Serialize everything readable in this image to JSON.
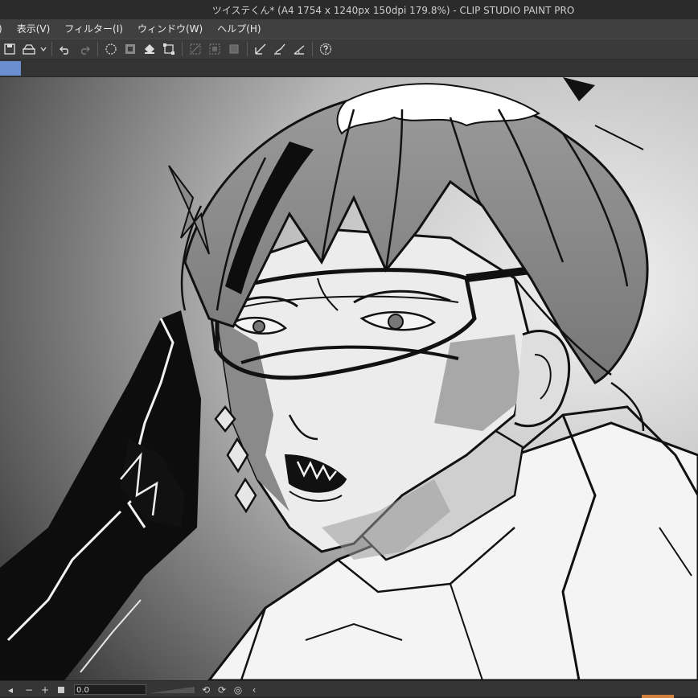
{
  "window": {
    "title": "ツイステくん* (A4 1754 x 1240px 150dpi 179.8%)  - CLIP STUDIO PAINT PRO"
  },
  "menubar": {
    "items": [
      {
        "label": ")"
      },
      {
        "label": "表示(V)"
      },
      {
        "label": "フィルター(I)"
      },
      {
        "label": "ウィンドウ(W)"
      },
      {
        "label": "ヘルプ(H)"
      }
    ]
  },
  "statusbar": {
    "zoom_value": "0.0",
    "minus": "−",
    "plus": "+"
  },
  "colors": {
    "accent_tab": "#6a8ed0",
    "status_accent": "#d0813e"
  }
}
